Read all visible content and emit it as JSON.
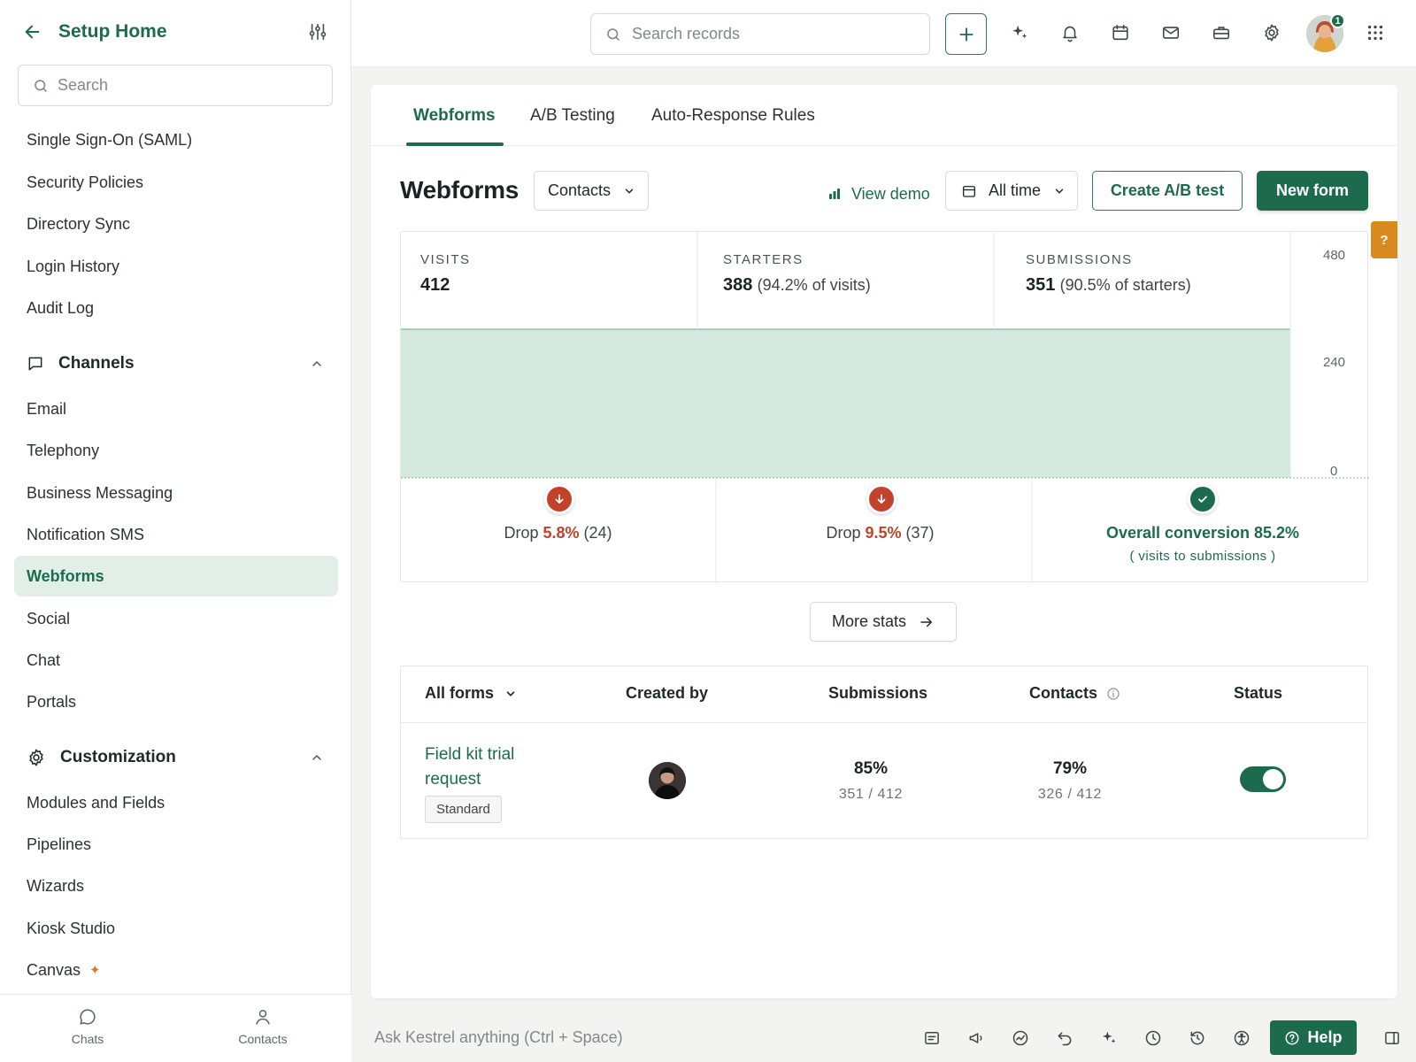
{
  "sidebar": {
    "title": "Setup Home",
    "search_placeholder": "Search",
    "items": [
      {
        "label": "Single Sign-On (SAML)"
      },
      {
        "label": "Security Policies"
      },
      {
        "label": "Directory Sync"
      },
      {
        "label": "Login History"
      },
      {
        "label": "Audit Log"
      }
    ],
    "channels": {
      "label": "Channels",
      "items": [
        {
          "label": "Email"
        },
        {
          "label": "Telephony"
        },
        {
          "label": "Business Messaging"
        },
        {
          "label": "Notification SMS"
        },
        {
          "label": "Webforms",
          "active": true
        },
        {
          "label": "Social"
        },
        {
          "label": "Chat"
        },
        {
          "label": "Portals"
        }
      ]
    },
    "customization": {
      "label": "Customization",
      "items": [
        {
          "label": "Modules and Fields"
        },
        {
          "label": "Pipelines"
        },
        {
          "label": "Wizards"
        },
        {
          "label": "Kiosk Studio"
        },
        {
          "label": "Canvas"
        }
      ]
    },
    "bottom": {
      "chats": "Chats",
      "contacts": "Contacts"
    }
  },
  "topbar": {
    "search_placeholder": "Search records",
    "notification_count": "1"
  },
  "tabs": [
    {
      "label": "Webforms",
      "active": true
    },
    {
      "label": "A/B Testing"
    },
    {
      "label": "Auto-Response Rules"
    }
  ],
  "page": {
    "title": "Webforms",
    "module_select": "Contacts",
    "view_demo": "View demo",
    "time_range": "All time",
    "create_ab": "Create A/B test",
    "new_form": "New form",
    "help_tab": "?"
  },
  "funnel": {
    "stages": [
      {
        "label": "VISITS",
        "value": "412",
        "pct": ""
      },
      {
        "label": "STARTERS",
        "value": "388",
        "pct": "(94.2% of visits)"
      },
      {
        "label": "SUBMISSIONS",
        "value": "351",
        "pct": "(90.5% of starters)"
      }
    ],
    "y_ticks": [
      "480",
      "240",
      "0"
    ],
    "drops": [
      {
        "prefix": "Drop",
        "pct": "5.8%",
        "count": "(24)"
      },
      {
        "prefix": "Drop",
        "pct": "9.5%",
        "count": "(37)"
      }
    ],
    "conversion": {
      "label": "Overall conversion 85.2%",
      "sub": "( visits to submissions )"
    },
    "more_stats": "More stats"
  },
  "chart_data": {
    "type": "area",
    "categories": [
      "Visits",
      "Starters",
      "Submissions"
    ],
    "values": [
      412,
      388,
      351
    ],
    "ylim": [
      0,
      480
    ],
    "yticks": [
      0,
      240,
      480
    ]
  },
  "table": {
    "headers": {
      "forms": "All forms",
      "created_by": "Created by",
      "submissions": "Submissions",
      "contacts": "Contacts",
      "status": "Status"
    },
    "rows": [
      {
        "name": "Field kit trial request",
        "tag": "Standard",
        "submissions_pct": "85%",
        "submissions_ratio": "351 / 412",
        "contacts_pct": "79%",
        "contacts_ratio": "326 / 412",
        "status_on": true
      }
    ]
  },
  "bottombar": {
    "ask_placeholder": "Ask Kestrel anything (Ctrl + Space)",
    "help": "Help"
  },
  "colors": {
    "brand": "#1c6b4d",
    "funnel_fill": "#d4e9dd",
    "drop_red": "#c4412c",
    "help_tab": "#d98a1e"
  }
}
